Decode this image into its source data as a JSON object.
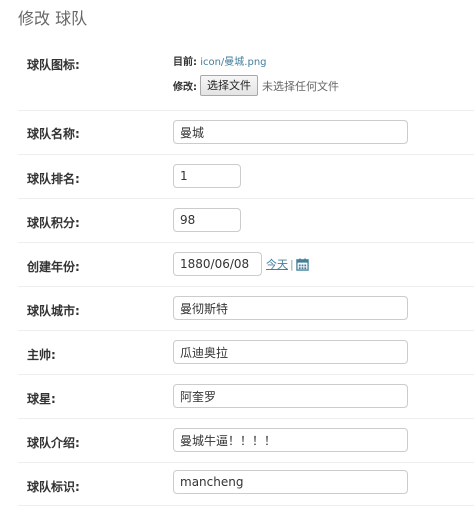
{
  "page": {
    "title": "修改 球队"
  },
  "form": {
    "icon": {
      "label": "球队图标:",
      "current_label": "目前:",
      "current_value": "icon/曼城.png",
      "change_label": "修改:",
      "button_label": "选择文件",
      "no_file_text": "未选择任何文件"
    },
    "name": {
      "label": "球队名称:",
      "value": "曼城"
    },
    "rank": {
      "label": "球队排名:",
      "value": "1"
    },
    "points": {
      "label": "球队积分:",
      "value": "98"
    },
    "founded": {
      "label": "创建年份:",
      "value": "1880/06/08",
      "today_label": "今天",
      "separator": "|"
    },
    "city": {
      "label": "球队城市:",
      "value": "曼彻斯特"
    },
    "coach": {
      "label": "主帅:",
      "value": "瓜迪奥拉"
    },
    "star": {
      "label": "球星:",
      "value": "阿奎罗"
    },
    "intro": {
      "label": "球队介绍:",
      "value": "曼城牛逼！！！！"
    },
    "identifier": {
      "label": "球队标识:",
      "value": "mancheng"
    }
  },
  "colors": {
    "link": "#447e9b",
    "border": "#cccccc",
    "divider": "#eeeeee"
  },
  "icons": {
    "calendar": "calendar-icon"
  }
}
